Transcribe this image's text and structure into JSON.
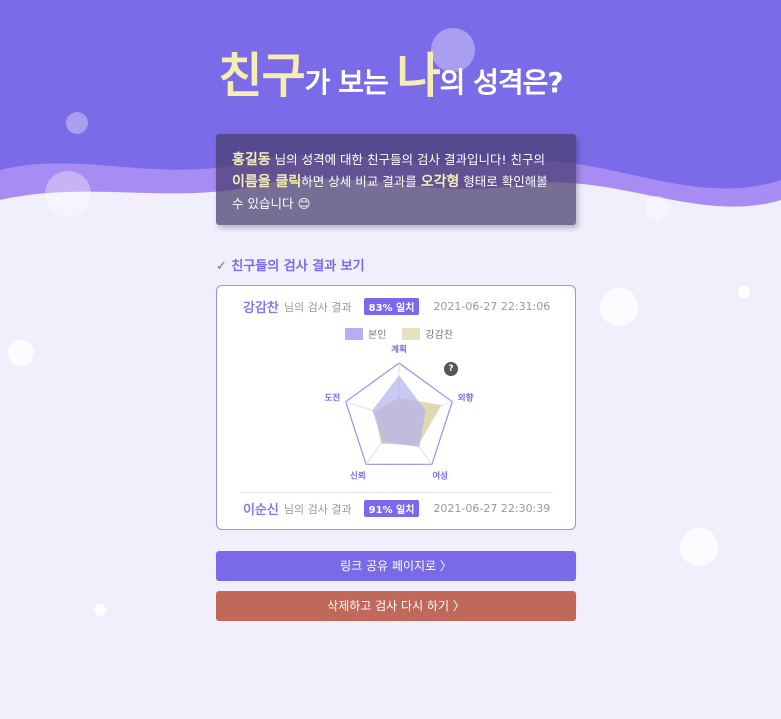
{
  "header": {
    "title_part1": "친구",
    "title_part2": "가 보는 ",
    "title_part3": "나",
    "title_part4": "의 성격은?"
  },
  "notice": {
    "user_name": "홍길동",
    "text1": " 님의 성격에 대한 친구들의 검사 결과입니다! 친구의 ",
    "highlight1": "이름을 클릭",
    "text2": "하면 상세 비교 결과를 ",
    "highlight2": "오각형",
    "text3": " 형태로 확인해볼 수 있습니다 ",
    "emoji": "😊"
  },
  "section_title": "✓ 친구들의 검사 결과 보기",
  "results": [
    {
      "name": "강감찬",
      "suffix": "님의 검사 결과",
      "match": "83% 일치",
      "datetime": "2021-06-27 22:31:06"
    },
    {
      "name": "이순신",
      "suffix": "님의 검사 결과",
      "match": "91% 일치",
      "datetime": "2021-06-27 22:30:39"
    }
  ],
  "legend": {
    "self": "본인",
    "friend": "강감찬"
  },
  "help_icon": "?",
  "chart_data": {
    "type": "radar",
    "axes": [
      "계획",
      "외향",
      "여성",
      "신뢰",
      "도전"
    ],
    "series": [
      {
        "name": "본인",
        "color": "#b4aff0",
        "values": [
          0.78,
          0.5,
          0.62,
          0.5,
          0.5
        ]
      },
      {
        "name": "강감찬",
        "color": "#d9d5a8",
        "values": [
          0.38,
          0.8,
          0.58,
          0.55,
          0.45
        ]
      }
    ],
    "range": [
      0,
      1
    ]
  },
  "buttons": {
    "share": "링크 공유 페이지로 〉",
    "retry": "삭제하고 검사 다시 하기 〉"
  },
  "colors": {
    "accent": "#7b68ee",
    "retry": "#c0695a",
    "highlight": "#f6eeb0"
  }
}
